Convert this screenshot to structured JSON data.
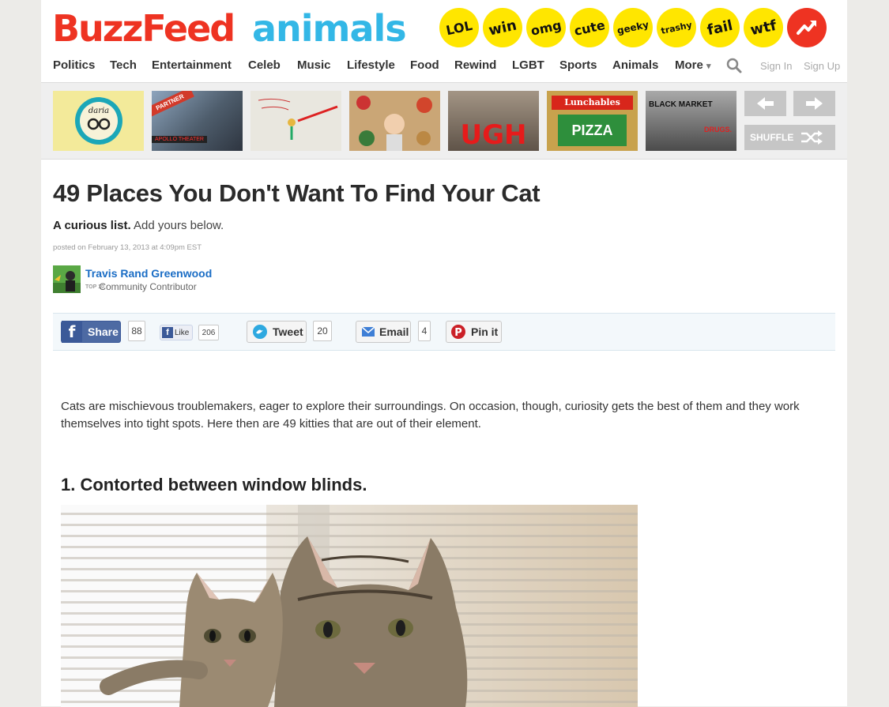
{
  "brand": {
    "logo": "BuzzFeed",
    "section": "animals"
  },
  "badges": [
    {
      "label": "LOL"
    },
    {
      "label": "win"
    },
    {
      "label": "omg"
    },
    {
      "label": "cute"
    },
    {
      "label": "geeky"
    },
    {
      "label": "trashy"
    },
    {
      "label": "fail"
    },
    {
      "label": "wtf"
    },
    {
      "icon": "trending-arrow-icon"
    }
  ],
  "nav": {
    "items": [
      "Politics",
      "Tech",
      "Entertainment",
      "Celeb",
      "Music",
      "Lifestyle",
      "Food",
      "Rewind",
      "LGBT",
      "Sports",
      "Animals",
      "More"
    ],
    "more_arrow": "▾",
    "sign_in": "Sign In",
    "sign_up": "Sign Up"
  },
  "strip": {
    "thumbs": [
      {
        "text": "daria"
      },
      {
        "text": "PARTNER",
        "sub": "APOLLO THEATER"
      },
      {
        "text": ""
      },
      {
        "text": ""
      },
      {
        "text": "UGH"
      },
      {
        "text": "Lunchables",
        "sub": "PIZZA"
      },
      {
        "text": "BLACK MARKET",
        "sub": "DRUGS."
      }
    ],
    "shuffle_label": "SHUFFLE"
  },
  "article": {
    "title": "49 Places You Don't Want To Find Your Cat",
    "subtitle_bold": "A curious list.",
    "subtitle_rest": " Add yours below.",
    "posted": "posted on February 13, 2013 at 4:09pm EST",
    "author": "Travis Rand Greenwood",
    "role_badge": "TOP 10",
    "role": "Community Contributor",
    "intro": "Cats are mischievous troublemakers, eager to explore their surroundings. On occasion, though, curiosity gets the best of them and they work themselves into tight spots. Here then are 49 kitties that are out of their element.",
    "item1_title": "1. Contorted between window blinds."
  },
  "share": {
    "facebook_label": "Share",
    "facebook_count": "88",
    "like_label": "Like",
    "like_count": "206",
    "tweet_label": "Tweet",
    "tweet_count": "20",
    "email_label": "Email",
    "email_count": "4",
    "pin_label": "Pin it"
  },
  "colors": {
    "brand_red": "#ee3322",
    "section_blue": "#33b7e6",
    "badge_yellow": "#ffe600",
    "link_blue": "#1a6dc5",
    "facebook_blue": "#3b5998"
  }
}
